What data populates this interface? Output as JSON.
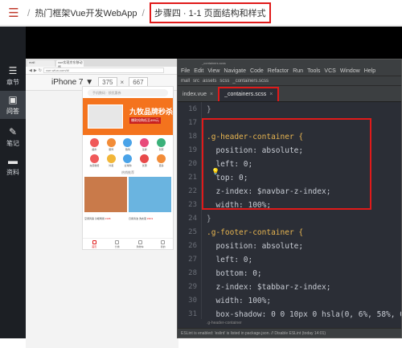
{
  "topbar": {
    "course_title": "热门框架Vue开发WebApp",
    "step_title": "步骤四 · 1-1 页面结构和样式"
  },
  "sidenav": {
    "items": [
      {
        "label": "章节",
        "icon": "list-icon"
      },
      {
        "label": "问答",
        "icon": "chat-icon"
      },
      {
        "label": "笔记",
        "icon": "pencil-icon"
      },
      {
        "label": "资料",
        "icon": "folder-icon"
      }
    ]
  },
  "browser": {
    "tabs": [
      "mall",
      "vue实现京东移动版"
    ],
    "url": "vue.wfun.com/#/",
    "device": "iPhone 7 ▼",
    "width": "375",
    "height": "667",
    "times": "×"
  },
  "phone": {
    "search_placeholder": "手机数码 · 领优惠券",
    "banner_big": "九牧品牌秒杀",
    "banner_small": "爆款抢购低至499元",
    "grid": [
      "超市",
      "服饰",
      "数码",
      "生鲜",
      "到家",
      "充值缴费",
      "外卖",
      "全球购",
      "优惠",
      "更多"
    ],
    "section_title": "热销推荐",
    "goods": [
      {
        "caption": "空调风扇 冷暖两用",
        "price": "¥198"
      },
      {
        "caption": "日用清洁 洗衣液",
        "price": "¥39.9"
      }
    ],
    "tabbar": [
      "首页",
      "分类",
      "购物车",
      "我的"
    ]
  },
  "editor": {
    "title": "_containers.scss",
    "menu": [
      "File",
      "Edit",
      "View",
      "Navigate",
      "Code",
      "Refactor",
      "Run",
      "Tools",
      "VCS",
      "Window",
      "Help"
    ],
    "crumbs": [
      "mall",
      "src",
      "assets",
      "scss",
      "_containers.scss"
    ],
    "tabs": [
      {
        "label": "index.vue",
        "active": false
      },
      {
        "label": "_containers.scss",
        "active": true
      }
    ],
    "line_numbers": [
      "16",
      "17",
      "18",
      "19",
      "20",
      "21",
      "22",
      "23",
      "24",
      "25",
      "26",
      "27",
      "28",
      "29",
      "30",
      "31"
    ],
    "lines": [
      "}",
      "",
      ".g-header-container {",
      "  position: absolute;",
      "  left: 0;",
      "  top: 0;",
      "  z-index: $navbar-z-index;",
      "  width: 100%;",
      "}",
      ".g-footer-container {",
      "  position: absolute;",
      "  left: 0;",
      "  bottom: 0;",
      "  z-index: $tabbar-z-index;",
      "  width: 100%;",
      "  box-shadow: 0 0 10px 0 hsla(0, 6%, 58%, 0."
    ],
    "status_line": ".g-header-container",
    "notification": "ESLint is enabled: 'eslint' is listed in package.json. // Disable ESLint (today 14:01)"
  },
  "colors": {
    "accent": "#e01a1a",
    "sidebar": "#1c1f24",
    "editor_bg": "#2b2e36"
  }
}
